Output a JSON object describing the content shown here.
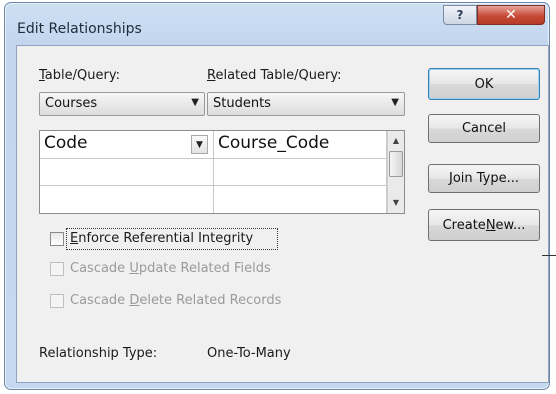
{
  "window": {
    "title": "Edit Relationships",
    "help_label": "?",
    "close_label": "✕"
  },
  "table_query": {
    "label_prefix": "T",
    "label_rest": "able/Query:",
    "selected": "Courses"
  },
  "related_table_query": {
    "label_prefix": "R",
    "label_rest": "elated Table/Query:",
    "selected": "Students"
  },
  "fields_grid": {
    "rows": [
      {
        "left": "Code",
        "right": "Course_Code"
      },
      {
        "left": "",
        "right": ""
      },
      {
        "left": "",
        "right": ""
      }
    ]
  },
  "buttons": {
    "ok": "OK",
    "cancel": "Cancel",
    "join_type_prefix": "J",
    "join_type_rest": "oin Type...",
    "create_new_prefix": "Create ",
    "create_new_u": "N",
    "create_new_rest": "ew..."
  },
  "options": {
    "enforce": {
      "prefix": "E",
      "rest": "nforce Referential Integrity",
      "checked": false
    },
    "cascade_update": {
      "before": "Cascade ",
      "u": "U",
      "rest": "pdate Related Fields",
      "checked": false
    },
    "cascade_delete": {
      "before": "Cascade ",
      "u": "D",
      "rest": "elete Related Records",
      "checked": false
    }
  },
  "relationship": {
    "label": "Relationship Type:",
    "value": "One-To-Many"
  },
  "icons": {
    "dropdown": "▼",
    "scroll_up": "▲",
    "scroll_down": "▼"
  }
}
